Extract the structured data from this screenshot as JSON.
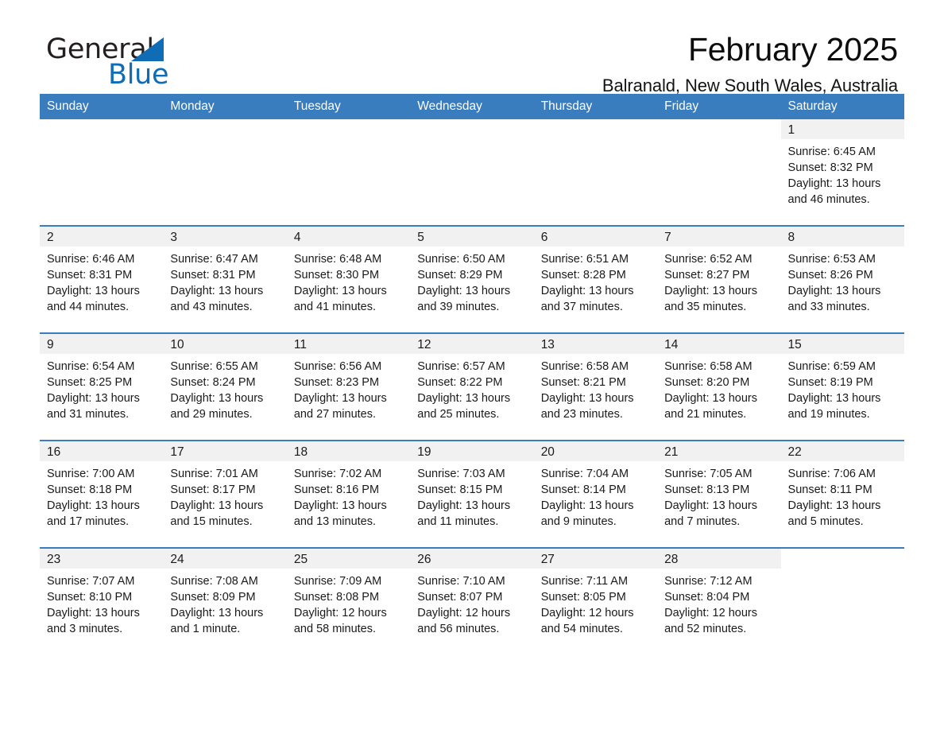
{
  "brand": {
    "name_dark": "General",
    "name_blue": "Blue",
    "logo_icon": "blue-triangle-icon",
    "accent_color": "#0f6cb5"
  },
  "header": {
    "month_title": "February 2025",
    "location": "Balranald, New South Wales, Australia"
  },
  "calendar": {
    "header_bg": "#3a7dbf",
    "daynum_bg": "#f1f1f1",
    "weekdays": [
      "Sunday",
      "Monday",
      "Tuesday",
      "Wednesday",
      "Thursday",
      "Friday",
      "Saturday"
    ],
    "weeks": [
      [
        {
          "blank": true
        },
        {
          "blank": true
        },
        {
          "blank": true
        },
        {
          "blank": true
        },
        {
          "blank": true
        },
        {
          "blank": true
        },
        {
          "day": "1",
          "sunrise": "Sunrise: 6:45 AM",
          "sunset": "Sunset: 8:32 PM",
          "daylight": "Daylight: 13 hours and 46 minutes."
        }
      ],
      [
        {
          "day": "2",
          "sunrise": "Sunrise: 6:46 AM",
          "sunset": "Sunset: 8:31 PM",
          "daylight": "Daylight: 13 hours and 44 minutes."
        },
        {
          "day": "3",
          "sunrise": "Sunrise: 6:47 AM",
          "sunset": "Sunset: 8:31 PM",
          "daylight": "Daylight: 13 hours and 43 minutes."
        },
        {
          "day": "4",
          "sunrise": "Sunrise: 6:48 AM",
          "sunset": "Sunset: 8:30 PM",
          "daylight": "Daylight: 13 hours and 41 minutes."
        },
        {
          "day": "5",
          "sunrise": "Sunrise: 6:50 AM",
          "sunset": "Sunset: 8:29 PM",
          "daylight": "Daylight: 13 hours and 39 minutes."
        },
        {
          "day": "6",
          "sunrise": "Sunrise: 6:51 AM",
          "sunset": "Sunset: 8:28 PM",
          "daylight": "Daylight: 13 hours and 37 minutes."
        },
        {
          "day": "7",
          "sunrise": "Sunrise: 6:52 AM",
          "sunset": "Sunset: 8:27 PM",
          "daylight": "Daylight: 13 hours and 35 minutes."
        },
        {
          "day": "8",
          "sunrise": "Sunrise: 6:53 AM",
          "sunset": "Sunset: 8:26 PM",
          "daylight": "Daylight: 13 hours and 33 minutes."
        }
      ],
      [
        {
          "day": "9",
          "sunrise": "Sunrise: 6:54 AM",
          "sunset": "Sunset: 8:25 PM",
          "daylight": "Daylight: 13 hours and 31 minutes."
        },
        {
          "day": "10",
          "sunrise": "Sunrise: 6:55 AM",
          "sunset": "Sunset: 8:24 PM",
          "daylight": "Daylight: 13 hours and 29 minutes."
        },
        {
          "day": "11",
          "sunrise": "Sunrise: 6:56 AM",
          "sunset": "Sunset: 8:23 PM",
          "daylight": "Daylight: 13 hours and 27 minutes."
        },
        {
          "day": "12",
          "sunrise": "Sunrise: 6:57 AM",
          "sunset": "Sunset: 8:22 PM",
          "daylight": "Daylight: 13 hours and 25 minutes."
        },
        {
          "day": "13",
          "sunrise": "Sunrise: 6:58 AM",
          "sunset": "Sunset: 8:21 PM",
          "daylight": "Daylight: 13 hours and 23 minutes."
        },
        {
          "day": "14",
          "sunrise": "Sunrise: 6:58 AM",
          "sunset": "Sunset: 8:20 PM",
          "daylight": "Daylight: 13 hours and 21 minutes."
        },
        {
          "day": "15",
          "sunrise": "Sunrise: 6:59 AM",
          "sunset": "Sunset: 8:19 PM",
          "daylight": "Daylight: 13 hours and 19 minutes."
        }
      ],
      [
        {
          "day": "16",
          "sunrise": "Sunrise: 7:00 AM",
          "sunset": "Sunset: 8:18 PM",
          "daylight": "Daylight: 13 hours and 17 minutes."
        },
        {
          "day": "17",
          "sunrise": "Sunrise: 7:01 AM",
          "sunset": "Sunset: 8:17 PM",
          "daylight": "Daylight: 13 hours and 15 minutes."
        },
        {
          "day": "18",
          "sunrise": "Sunrise: 7:02 AM",
          "sunset": "Sunset: 8:16 PM",
          "daylight": "Daylight: 13 hours and 13 minutes."
        },
        {
          "day": "19",
          "sunrise": "Sunrise: 7:03 AM",
          "sunset": "Sunset: 8:15 PM",
          "daylight": "Daylight: 13 hours and 11 minutes."
        },
        {
          "day": "20",
          "sunrise": "Sunrise: 7:04 AM",
          "sunset": "Sunset: 8:14 PM",
          "daylight": "Daylight: 13 hours and 9 minutes."
        },
        {
          "day": "21",
          "sunrise": "Sunrise: 7:05 AM",
          "sunset": "Sunset: 8:13 PM",
          "daylight": "Daylight: 13 hours and 7 minutes."
        },
        {
          "day": "22",
          "sunrise": "Sunrise: 7:06 AM",
          "sunset": "Sunset: 8:11 PM",
          "daylight": "Daylight: 13 hours and 5 minutes."
        }
      ],
      [
        {
          "day": "23",
          "sunrise": "Sunrise: 7:07 AM",
          "sunset": "Sunset: 8:10 PM",
          "daylight": "Daylight: 13 hours and 3 minutes."
        },
        {
          "day": "24",
          "sunrise": "Sunrise: 7:08 AM",
          "sunset": "Sunset: 8:09 PM",
          "daylight": "Daylight: 13 hours and 1 minute."
        },
        {
          "day": "25",
          "sunrise": "Sunrise: 7:09 AM",
          "sunset": "Sunset: 8:08 PM",
          "daylight": "Daylight: 12 hours and 58 minutes."
        },
        {
          "day": "26",
          "sunrise": "Sunrise: 7:10 AM",
          "sunset": "Sunset: 8:07 PM",
          "daylight": "Daylight: 12 hours and 56 minutes."
        },
        {
          "day": "27",
          "sunrise": "Sunrise: 7:11 AM",
          "sunset": "Sunset: 8:05 PM",
          "daylight": "Daylight: 12 hours and 54 minutes."
        },
        {
          "day": "28",
          "sunrise": "Sunrise: 7:12 AM",
          "sunset": "Sunset: 8:04 PM",
          "daylight": "Daylight: 12 hours and 52 minutes."
        },
        {
          "blank": true
        }
      ]
    ]
  }
}
